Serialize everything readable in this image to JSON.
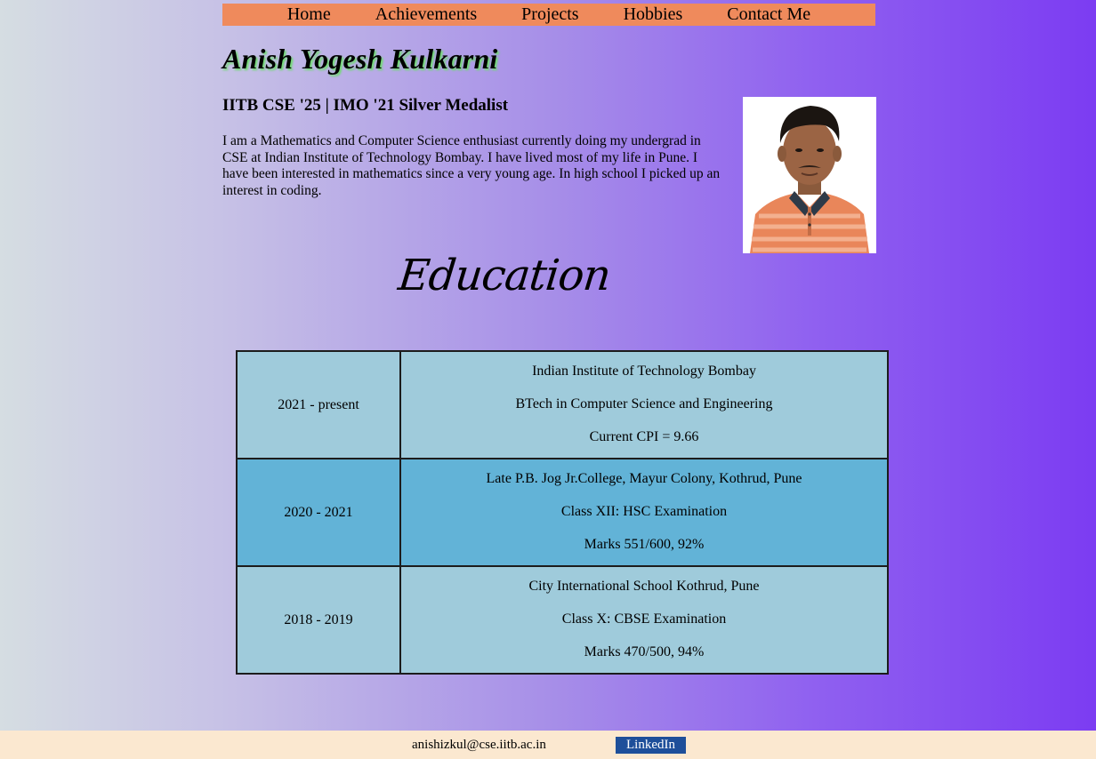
{
  "nav": {
    "items": [
      {
        "label": "Home"
      },
      {
        "label": "Achievements"
      },
      {
        "label": "Projects"
      },
      {
        "label": "Hobbies"
      },
      {
        "label": "Contact Me"
      }
    ],
    "background": "#ef8a5c"
  },
  "profile": {
    "name": "Anish Yogesh Kulkarni",
    "subtitle": "IITB CSE '25 | IMO '21 Silver Medalist",
    "bio": "I am a Mathematics and Computer Science enthusiast currently doing my undergrad in CSE at Indian Institute of Technology Bombay. I have lived most of my life in Pune. I have been interested in mathematics since a very young age. In high school I picked up an interest in coding."
  },
  "education": {
    "heading": "Education",
    "rows": [
      {
        "year": "2021 - present",
        "lines": [
          "Indian Institute of Technology Bombay",
          "BTech in Computer Science and Engineering",
          "Current CPI = 9.66"
        ]
      },
      {
        "year": "2020 - 2021",
        "lines": [
          "Late P.B. Jog Jr.College, Mayur Colony, Kothrud, Pune",
          "Class XII: HSC Examination",
          "Marks 551/600, 92%"
        ]
      },
      {
        "year": "2018 - 2019",
        "lines": [
          "City International School Kothrud, Pune",
          "Class X: CBSE Examination",
          "Marks 470/500, 94%"
        ]
      }
    ]
  },
  "footer": {
    "email": "anishizkul@cse.iitb.ac.in",
    "linkedin_label": "LinkedIn"
  },
  "colors": {
    "table_light": "#9fcbdb",
    "table_dark": "#62b3d7",
    "footer_bg": "#fbe8d0",
    "linkedin_bg": "#1e4f9a"
  }
}
